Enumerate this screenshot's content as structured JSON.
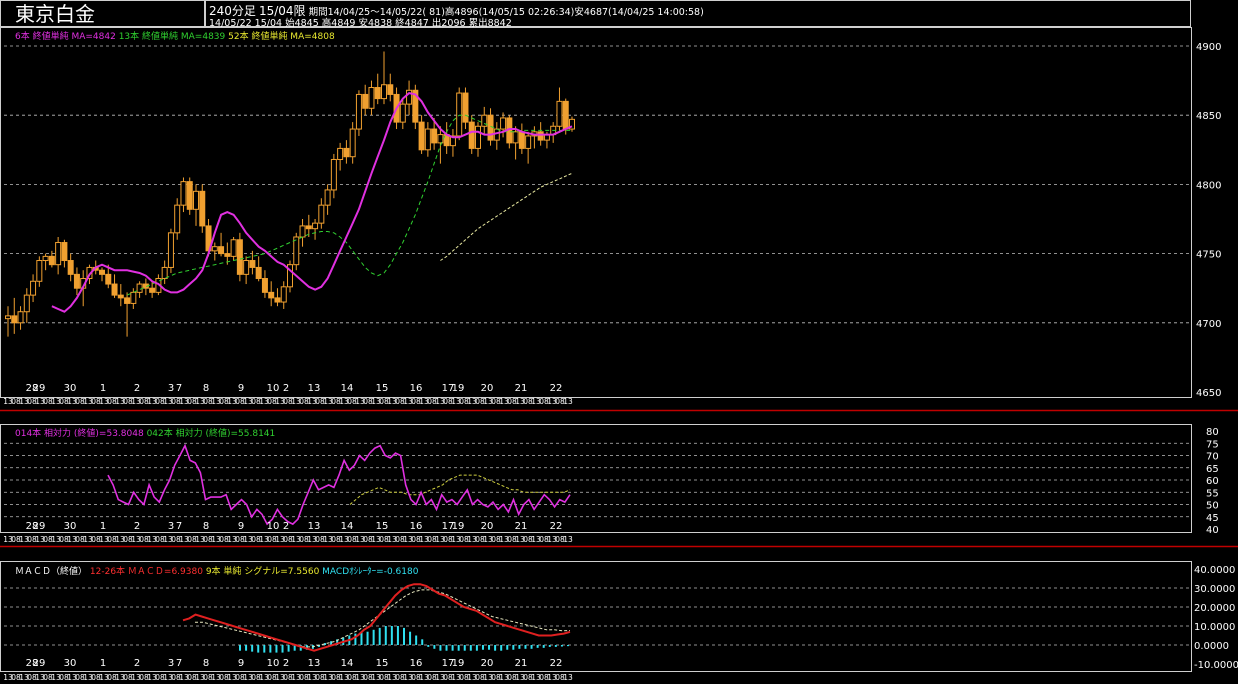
{
  "window": {
    "title": "東京白金"
  },
  "info": {
    "timeframe": "240分足",
    "contract": "15/04限",
    "period": "期間14/04/25〜14/05/22( 81)高4896(14/05/15 02:26:34)安4687(14/04/25 14:00:58)",
    "ohlc": "14/05/22 15/04 始4845 高4849 安4838 終4847 出2096 累出8842"
  },
  "price_panel": {
    "legend": [
      {
        "text": "6本 終値単純 MA=4842",
        "color": "#e030e0"
      },
      {
        "text": "13本 終値単純 MA=4839",
        "color": "#30d030"
      },
      {
        "text": "52本 終値単純 MA=4808",
        "color": "#e8e830"
      }
    ],
    "y_ticks": [
      "4900",
      "4850",
      "4800",
      "4750",
      "4700",
      "4650"
    ]
  },
  "rsi_panel": {
    "legend": [
      {
        "text": "014本 相対力 (終値)=53.8048",
        "color": "#e030e0"
      },
      {
        "text": "042本 相対力 (終値)=55.8141",
        "color": "#30d030"
      }
    ],
    "y_ticks": [
      "80",
      "75",
      "70",
      "65",
      "60",
      "55",
      "50",
      "45",
      "40"
    ]
  },
  "macd_panel": {
    "legend": [
      {
        "text": "ＭＡＣＤ（終値）",
        "color": "#ffffff"
      },
      {
        "text": "12-26本 ＭＡＣＤ=6.9380",
        "color": "#ff3030"
      },
      {
        "text": "9本 単純 シグナル=7.5560",
        "color": "#e8e830"
      },
      {
        "text": "MACDｵｼﾚｰﾀｰ=-0.6180",
        "color": "#30e0f0"
      }
    ],
    "y_ticks": [
      "40.0000",
      "30.0000",
      "20.0000",
      "10.0000",
      "0.0000",
      "-10.0000"
    ]
  },
  "x_axis": {
    "day_labels": [
      "28",
      "29",
      "30",
      "1",
      "2",
      "3",
      "7",
      "8",
      "9",
      "10",
      "2",
      "13",
      "14",
      "15",
      "16",
      "17",
      "19",
      "20",
      "21",
      "22"
    ],
    "hour_tick_text": "13",
    "hour_tick_text2": "08"
  },
  "chart_data": [
    {
      "type": "candlestick",
      "title": "東京白金",
      "ylim": [
        4650,
        4900
      ],
      "candles": [
        [
          4703,
          4712,
          4690,
          4705
        ],
        [
          4705,
          4718,
          4692,
          4700
        ],
        [
          4700,
          4712,
          4695,
          4708
        ],
        [
          4708,
          4725,
          4700,
          4720
        ],
        [
          4720,
          4735,
          4715,
          4730
        ],
        [
          4730,
          4748,
          4726,
          4745
        ],
        [
          4745,
          4750,
          4738,
          4748
        ],
        [
          4748,
          4752,
          4740,
          4742
        ],
        [
          4742,
          4762,
          4735,
          4758
        ],
        [
          4758,
          4760,
          4740,
          4745
        ],
        [
          4745,
          4750,
          4730,
          4735
        ],
        [
          4735,
          4740,
          4720,
          4725
        ],
        [
          4725,
          4738,
          4712,
          4732
        ],
        [
          4732,
          4742,
          4728,
          4740
        ],
        [
          4740,
          4745,
          4735,
          4738
        ],
        [
          4738,
          4740,
          4730,
          4735
        ],
        [
          4735,
          4742,
          4725,
          4728
        ],
        [
          4728,
          4735,
          4718,
          4720
        ],
        [
          4720,
          4728,
          4712,
          4718
        ],
        [
          4718,
          4722,
          4690,
          4714
        ],
        [
          4714,
          4725,
          4710,
          4722
        ],
        [
          4722,
          4730,
          4718,
          4728
        ],
        [
          4728,
          4732,
          4720,
          4725
        ],
        [
          4725,
          4730,
          4718,
          4722
        ],
        [
          4722,
          4735,
          4720,
          4732
        ],
        [
          4732,
          4745,
          4728,
          4740
        ],
        [
          4740,
          4768,
          4736,
          4765
        ],
        [
          4765,
          4790,
          4760,
          4785
        ],
        [
          4785,
          4805,
          4780,
          4802
        ],
        [
          4802,
          4805,
          4778,
          4782
        ],
        [
          4782,
          4800,
          4770,
          4795
        ],
        [
          4795,
          4800,
          4765,
          4770
        ],
        [
          4770,
          4775,
          4748,
          4752
        ],
        [
          4752,
          4758,
          4745,
          4755
        ],
        [
          4755,
          4765,
          4748,
          4750
        ],
        [
          4750,
          4758,
          4742,
          4748
        ],
        [
          4748,
          4762,
          4745,
          4760
        ],
        [
          4760,
          4765,
          4730,
          4735
        ],
        [
          4735,
          4748,
          4728,
          4745
        ],
        [
          4745,
          4752,
          4735,
          4740
        ],
        [
          4740,
          4748,
          4730,
          4732
        ],
        [
          4732,
          4738,
          4718,
          4722
        ],
        [
          4722,
          4730,
          4712,
          4718
        ],
        [
          4718,
          4725,
          4712,
          4715
        ],
        [
          4715,
          4730,
          4710,
          4726
        ],
        [
          4726,
          4745,
          4722,
          4742
        ],
        [
          4742,
          4765,
          4738,
          4762
        ],
        [
          4762,
          4775,
          4755,
          4770
        ],
        [
          4770,
          4778,
          4762,
          4768
        ],
        [
          4768,
          4775,
          4760,
          4772
        ],
        [
          4772,
          4790,
          4768,
          4785
        ],
        [
          4785,
          4800,
          4778,
          4796
        ],
        [
          4796,
          4822,
          4790,
          4818
        ],
        [
          4818,
          4830,
          4810,
          4826
        ],
        [
          4826,
          4832,
          4815,
          4820
        ],
        [
          4820,
          4845,
          4815,
          4840
        ],
        [
          4840,
          4868,
          4835,
          4865
        ],
        [
          4865,
          4872,
          4850,
          4855
        ],
        [
          4855,
          4875,
          4850,
          4870
        ],
        [
          4870,
          4880,
          4858,
          4862
        ],
        [
          4862,
          4896,
          4858,
          4872
        ],
        [
          4872,
          4880,
          4860,
          4865
        ],
        [
          4865,
          4870,
          4840,
          4845
        ],
        [
          4845,
          4862,
          4840,
          4858
        ],
        [
          4858,
          4875,
          4850,
          4868
        ],
        [
          4868,
          4872,
          4840,
          4845
        ],
        [
          4845,
          4850,
          4822,
          4825
        ],
        [
          4825,
          4845,
          4820,
          4840
        ],
        [
          4840,
          4848,
          4825,
          4830
        ],
        [
          4830,
          4842,
          4815,
          4836
        ],
        [
          4836,
          4845,
          4822,
          4828
        ],
        [
          4828,
          4840,
          4820,
          4835
        ],
        [
          4835,
          4870,
          4832,
          4866
        ],
        [
          4866,
          4870,
          4840,
          4845
        ],
        [
          4845,
          4850,
          4822,
          4826
        ],
        [
          4826,
          4845,
          4820,
          4842
        ],
        [
          4842,
          4856,
          4836,
          4850
        ],
        [
          4850,
          4855,
          4828,
          4832
        ],
        [
          4832,
          4845,
          4825,
          4840
        ],
        [
          4840,
          4852,
          4834,
          4848
        ],
        [
          4848,
          4850,
          4826,
          4830
        ],
        [
          4830,
          4842,
          4818,
          4838
        ],
        [
          4838,
          4844,
          4822,
          4826
        ],
        [
          4826,
          4838,
          4815,
          4835
        ],
        [
          4835,
          4842,
          4826,
          4838
        ],
        [
          4838,
          4845,
          4828,
          4832
        ],
        [
          4832,
          4838,
          4826,
          4836
        ],
        [
          4836,
          4845,
          4830,
          4842
        ],
        [
          4842,
          4870,
          4838,
          4860
        ],
        [
          4860,
          4862,
          4836,
          4840
        ],
        [
          4840,
          4849,
          4838,
          4847
        ]
      ],
      "ma6": [
        4712,
        4710,
        4708,
        4712,
        4718,
        4726,
        4735,
        4740,
        4742,
        4740,
        4738,
        4738,
        4738,
        4737,
        4736,
        4734,
        4730,
        4728,
        4724,
        4722,
        4722,
        4724,
        4728,
        4732,
        4738,
        4750,
        4765,
        4778,
        4780,
        4778,
        4772,
        4765,
        4760,
        4755,
        4752,
        4748,
        4744,
        4742,
        4738,
        4734,
        4730,
        4726,
        4724,
        4726,
        4732,
        4742,
        4752,
        4762,
        4772,
        4782,
        4795,
        4808,
        4820,
        4832,
        4845,
        4855,
        4862,
        4866,
        4865,
        4860,
        4852,
        4846,
        4840,
        4836,
        4834,
        4834,
        4836,
        4838,
        4838,
        4836,
        4836,
        4837,
        4838,
        4840,
        4840,
        4838,
        4837,
        4836,
        4836,
        4836,
        4836,
        4838,
        4840,
        4842
      ],
      "ma13": [
        4720,
        4722,
        4724,
        4726,
        4728,
        4730,
        4732,
        4734,
        4736,
        4737,
        4738,
        4739,
        4740,
        4741,
        4742,
        4743,
        4744,
        4745,
        4746,
        4747,
        4748,
        4749,
        4750,
        4752,
        4754,
        4756,
        4758,
        4760,
        4762,
        4764,
        4765,
        4766,
        4766,
        4765,
        4762,
        4758,
        4752,
        4746,
        4740,
        4736,
        4734,
        4736,
        4742,
        4750,
        4758,
        4768,
        4778,
        4790,
        4802,
        4815,
        4828,
        4838,
        4846,
        4850,
        4850,
        4848,
        4846,
        4844,
        4842,
        4840,
        4838,
        4838,
        4838,
        4839,
        4839,
        4839,
        4839,
        4839,
        4839,
        4839,
        4839,
        4839
      ],
      "ma52": [
        4745,
        4748,
        4752,
        4756,
        4760,
        4764,
        4768,
        4771,
        4774,
        4777,
        4780,
        4783,
        4786,
        4789,
        4792,
        4795,
        4798,
        4800,
        4802,
        4804,
        4806,
        4808
      ]
    },
    {
      "type": "line",
      "ylim": [
        40,
        80
      ],
      "series": [
        {
          "name": "014本 相対力 (終値)",
          "values": [
            62,
            58,
            52,
            51,
            50,
            55,
            52,
            50,
            58,
            53,
            51,
            56,
            60,
            66,
            70,
            74,
            68,
            67,
            63,
            52,
            53,
            53,
            53,
            54,
            48,
            50,
            52,
            50,
            45,
            48,
            46,
            42,
            44,
            48,
            45,
            43,
            42,
            44,
            50,
            55,
            60,
            56,
            57,
            58,
            57,
            62,
            68,
            64,
            66,
            70,
            68,
            71,
            73,
            74,
            70,
            69,
            71,
            70,
            58,
            52,
            50,
            55,
            50,
            52,
            48,
            54,
            51,
            52,
            50,
            53,
            56,
            50,
            52,
            50,
            49,
            51,
            48,
            50,
            47,
            52,
            46,
            50,
            52,
            48,
            51,
            54,
            52,
            49,
            52,
            51,
            54
          ]
        },
        {
          "name": "042本 相対力 (終値)",
          "values": [
            50,
            52,
            54,
            55,
            56,
            57,
            56,
            55,
            55,
            55,
            54,
            54,
            54,
            55,
            56,
            57,
            58,
            60,
            61,
            62,
            62,
            62,
            62,
            61,
            60,
            59,
            58,
            57,
            56,
            56,
            55,
            55,
            55,
            55,
            55,
            55,
            55,
            55,
            56
          ]
        }
      ]
    },
    {
      "type": "line",
      "ylim": [
        -10,
        40
      ],
      "series": [
        {
          "name": "12-26本 ＭＡＣＤ",
          "values": [
            13,
            14,
            16,
            15,
            14,
            13,
            12,
            11,
            10,
            9,
            8,
            7,
            6,
            5,
            4,
            3,
            2,
            1,
            0,
            -1,
            -2,
            -3,
            -2,
            -1,
            0,
            1,
            2,
            3,
            5,
            8,
            10,
            14,
            18,
            22,
            26,
            29,
            31,
            32,
            32,
            31,
            29,
            27,
            26,
            24,
            22,
            20,
            19,
            18,
            16,
            14,
            12,
            11,
            10,
            9,
            8,
            7,
            6,
            5,
            5,
            5,
            5.5,
            6,
            6.9
          ]
        },
        {
          "name": "9本 単純 シグナル",
          "values": [
            12,
            12,
            11,
            10,
            9,
            8,
            7,
            6,
            5,
            4,
            3,
            2,
            1,
            0,
            -1,
            -1,
            0,
            1,
            2,
            4,
            6,
            8,
            11,
            14,
            17,
            20,
            23,
            26,
            28,
            29,
            29,
            28,
            27,
            25,
            23,
            21,
            19,
            17,
            15,
            14,
            13,
            12,
            11,
            10,
            9,
            8,
            8,
            7.5,
            7.6
          ]
        },
        {
          "name": "MACDｵｼﾚｰﾀｰ",
          "values": [
            -3,
            -3,
            -3.5,
            -4,
            -4,
            -4,
            -4,
            -4,
            -3.5,
            -3,
            -3,
            -2.5,
            -2,
            -1,
            1,
            2,
            3,
            4,
            5,
            6,
            7,
            7,
            8,
            9,
            10,
            10,
            10,
            9,
            7,
            5,
            3,
            -1,
            -2,
            -3,
            -3,
            -3,
            -3,
            -3,
            -3,
            -3,
            -2.5,
            -2.5,
            -3,
            -3,
            -2.5,
            -2.5,
            -2,
            -2,
            -2,
            -1.5,
            -1.5,
            -1,
            -1,
            -0.8,
            -0.6
          ]
        }
      ]
    }
  ]
}
